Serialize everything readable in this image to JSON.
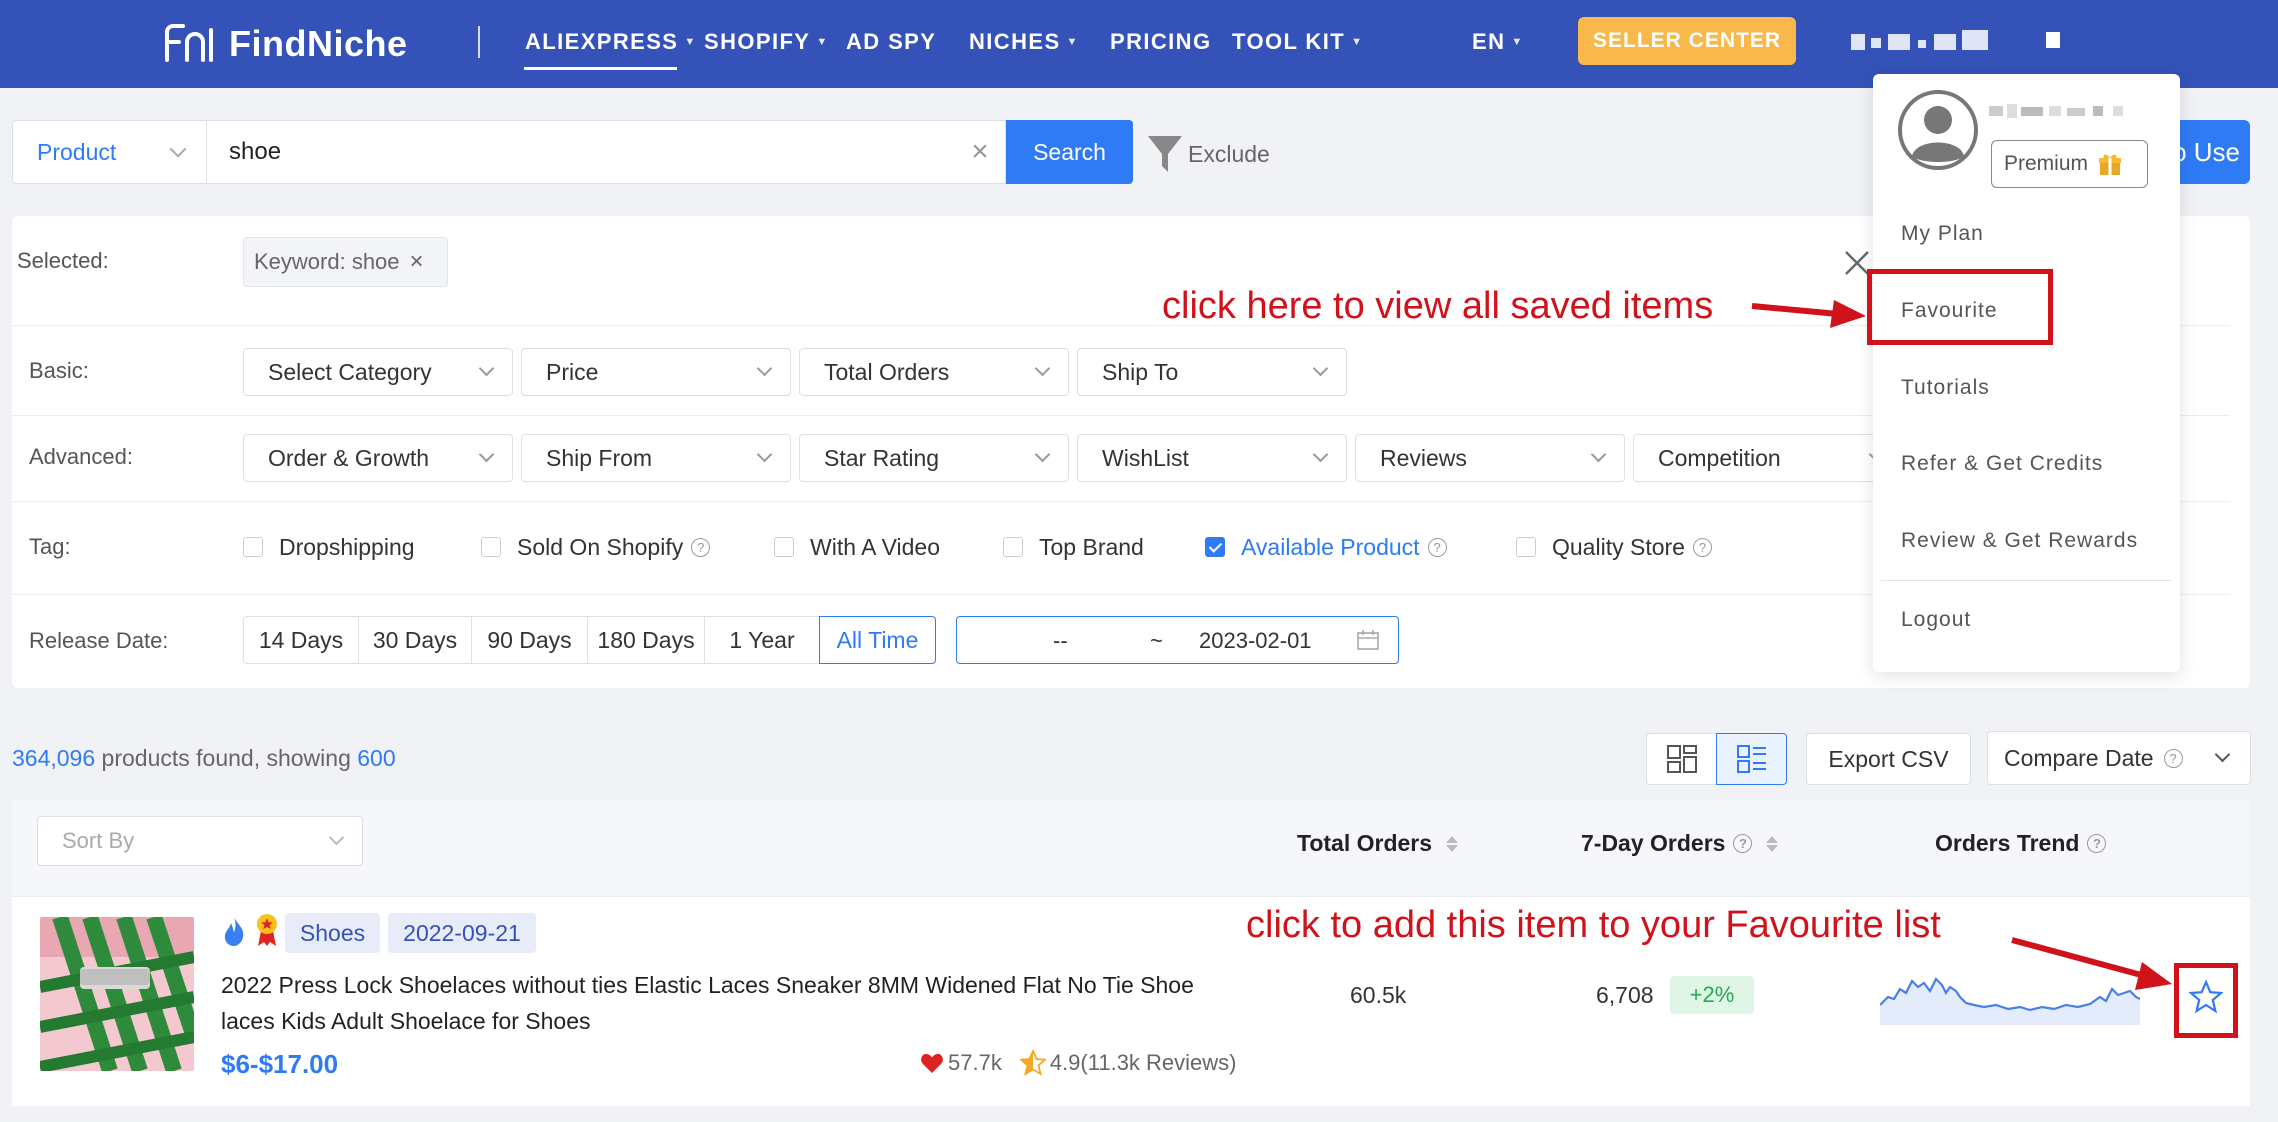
{
  "nav": {
    "brand": "FindNiche",
    "items": [
      {
        "label": "ALIEXPRESS",
        "has_caret": true,
        "active": true
      },
      {
        "label": "SHOPIFY",
        "has_caret": true
      },
      {
        "label": "AD SPY",
        "has_caret": false
      },
      {
        "label": "NICHES",
        "has_caret": true
      },
      {
        "label": "PRICING",
        "has_caret": false
      },
      {
        "label": "TOOL KIT",
        "has_caret": true
      }
    ],
    "language": "EN",
    "seller_center": "SELLER CENTER"
  },
  "search": {
    "type": "Product",
    "query": "shoe",
    "button": "Search",
    "exclude": "Exclude",
    "how_to_use_partial": "o Use"
  },
  "filters": {
    "selected_label": "Selected:",
    "selected_chip": "Keyword: shoe",
    "basic_label": "Basic:",
    "basic": [
      "Select Category",
      "Price",
      "Total Orders",
      "Ship To"
    ],
    "advanced_label": "Advanced:",
    "advanced": [
      "Order & Growth",
      "Ship From",
      "Star Rating",
      "WishList",
      "Reviews",
      "Competition"
    ],
    "tag_label": "Tag:",
    "tags": [
      {
        "label": "Dropshipping",
        "checked": false,
        "help": false
      },
      {
        "label": "Sold On Shopify",
        "checked": false,
        "help": true
      },
      {
        "label": "With A Video",
        "checked": false,
        "help": false
      },
      {
        "label": "Top Brand",
        "checked": false,
        "help": false
      },
      {
        "label": "Available Product",
        "checked": true,
        "help": true
      },
      {
        "label": "Quality Store",
        "checked": false,
        "help": true
      }
    ],
    "release_label": "Release Date:",
    "release_options": [
      "14 Days",
      "30 Days",
      "90 Days",
      "180 Days",
      "1 Year",
      "All Time"
    ],
    "release_active": "All Time",
    "date_from": "--",
    "date_sep": "~",
    "date_to": "2023-02-01"
  },
  "results": {
    "count": "364,096",
    "middle": " products found, showing ",
    "showing": "600",
    "export": "Export CSV",
    "compare": "Compare Date"
  },
  "table": {
    "sort_placeholder": "Sort By",
    "col_total_orders": "Total Orders",
    "col_7day": "7-Day Orders",
    "col_trend": "Orders Trend",
    "row": {
      "category": "Shoes",
      "date": "2022-09-21",
      "title": "2022 Press Lock Shoelaces without ties Elastic Laces Sneaker 8MM Widened Flat No Tie Shoe laces Kids Adult Shoelace for Shoes",
      "price": "$6-$17.00",
      "wishlist": "57.7k",
      "rating": "4.9(11.3k Reviews)",
      "total_orders": "60.5k",
      "orders_7d": "6,708",
      "growth": "+2%"
    }
  },
  "user_menu": {
    "plan_badge": "Premium",
    "items": [
      "My Plan",
      "Favourite",
      "Tutorials",
      "Refer & Get Credits",
      "Review & Get Rewards",
      "Logout"
    ]
  },
  "annotations": {
    "favourite_hint": "click here to view all saved items",
    "star_hint": "click to add this item to your Favourite list"
  },
  "colors": {
    "nav_bg": "#3452b8",
    "accent": "#2f7bf5",
    "seller_btn": "#f8b84a",
    "annotation": "#d0121b",
    "growth_bg": "#dff6e6"
  }
}
